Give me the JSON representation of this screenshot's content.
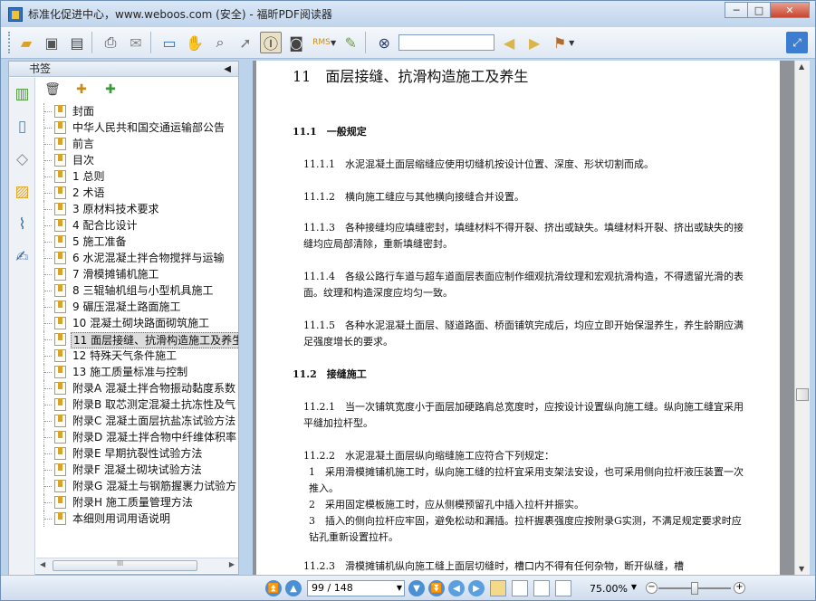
{
  "window": {
    "title": "标准化促进中心，www.weboos.com (安全) - 福昕PDF阅读器"
  },
  "window_buttons": {
    "minimize": "─",
    "maximize": "□",
    "close": "✕"
  },
  "toolbar": {
    "icons": [
      "open-folder-icon",
      "save-icon",
      "save-as-icon",
      "print-icon",
      "email-icon",
      "fullscreen-monitor-icon",
      "hand-tool-icon",
      "zoom-magnifier-icon",
      "select-arrow-icon",
      "text-select-icon",
      "snapshot-camera-icon",
      "rms-lock-icon",
      "sign-pen-icon",
      "find-binoculars-icon"
    ],
    "search_value": "",
    "rms_label": "RMS"
  },
  "sidebar": {
    "title": "书签",
    "close_glyph": "◀",
    "bookmarks": [
      {
        "label": "封面"
      },
      {
        "label": "中华人民共和国交通运输部公告"
      },
      {
        "label": "前言"
      },
      {
        "label": "目次"
      },
      {
        "label": "1 总则"
      },
      {
        "label": "2 术语"
      },
      {
        "label": "3 原材料技术要求"
      },
      {
        "label": "4 配合比设计"
      },
      {
        "label": "5 施工准备"
      },
      {
        "label": "6 水泥混凝土拌合物搅拌与运输"
      },
      {
        "label": "7 滑模摊铺机施工"
      },
      {
        "label": "8 三辊轴机组与小型机具施工"
      },
      {
        "label": "9 碾压混凝土路面施工"
      },
      {
        "label": "10 混凝土砌块路面砌筑施工"
      },
      {
        "label": "11 面层接缝、抗滑构造施工及养生"
      },
      {
        "label": "12 特殊天气条件施工"
      },
      {
        "label": "13 施工质量标准与控制"
      },
      {
        "label": "附录A 混凝土拌合物振动黏度系数"
      },
      {
        "label": "附录B 取芯测定混凝土抗冻性及气"
      },
      {
        "label": "附录C 混凝土面层抗盐冻试验方法"
      },
      {
        "label": "附录D 混凝土拌合物中纤维体积率"
      },
      {
        "label": "附录E 早期抗裂性试验方法"
      },
      {
        "label": "附录F 混凝土砌块试验方法"
      },
      {
        "label": "附录G 混凝土与钢筋握裹力试验方"
      },
      {
        "label": "附录H 施工质量管理方法"
      },
      {
        "label": "本细则用词用语说明"
      }
    ],
    "active_index": 14,
    "hscroll_marker": "III"
  },
  "document": {
    "chapter_title": "11　面层接缝、抗滑构造施工及养生",
    "paragraphs": [
      {
        "text": "11.1　一般规定",
        "bold": true
      },
      {
        "text": "11.1.1　水泥混凝土面层缩缝应使用切缝机按设计位置、深度、形状切割而成。"
      },
      {
        "text": "11.1.2　横向施工缝应与其他横向接缝合并设置。"
      },
      {
        "text": "11.1.3　各种接缝均应填缝密封，填缝材料不得开裂、挤出或缺失。填缝材料开裂、挤出或缺失的接缝均应局部清除，重新填缝密封。"
      },
      {
        "text": "11.1.4　各级公路行车道与超车道面层表面应制作细观抗滑纹理和宏观抗滑构造，不得遗留光滑的表面。纹理和构造深度应均匀一致。"
      },
      {
        "text": "11.1.5　各种水泥混凝土面层、隧道路面、桥面铺筑完成后，均应立即开始保湿养生，养生龄期应满足强度增长的要求。"
      },
      {
        "text": "11.2　接缝施工",
        "bold": true
      },
      {
        "text": "11.2.1　当一次铺筑宽度小于面层加硬路肩总宽度时，应按设计设置纵向施工缝。纵向施工缝宜采用平缝加拉杆型。"
      },
      {
        "text": "11.2.2　水泥混凝土面层纵向缩缝施工应符合下列规定："
      },
      {
        "text": "1　采用滑模摊铺机施工时，纵向施工缝的拉杆宜采用支架法安设，也可采用侧向拉杆液压装置一次推入。"
      },
      {
        "text": "2　采用固定模板施工时，应从侧模预留孔中插入拉杆并振实。"
      },
      {
        "text": "3　插入的侧向拉杆应牢固，避免松动和漏插。拉杆握裹强度应按附录G实测，不满足规定要求时应钻孔重新设置拉杆。"
      },
      {
        "text": "11.2.3　滑模摊铺机纵向施工缝上面层切缝时，槽口内不得有任何杂物，断开纵缝，槽"
      }
    ]
  },
  "statusbar": {
    "page_display": "99 / 148",
    "zoom": "75.00%",
    "zoom_minus": "−",
    "zoom_plus": "+",
    "zoom_level_fraction": 0.5
  }
}
